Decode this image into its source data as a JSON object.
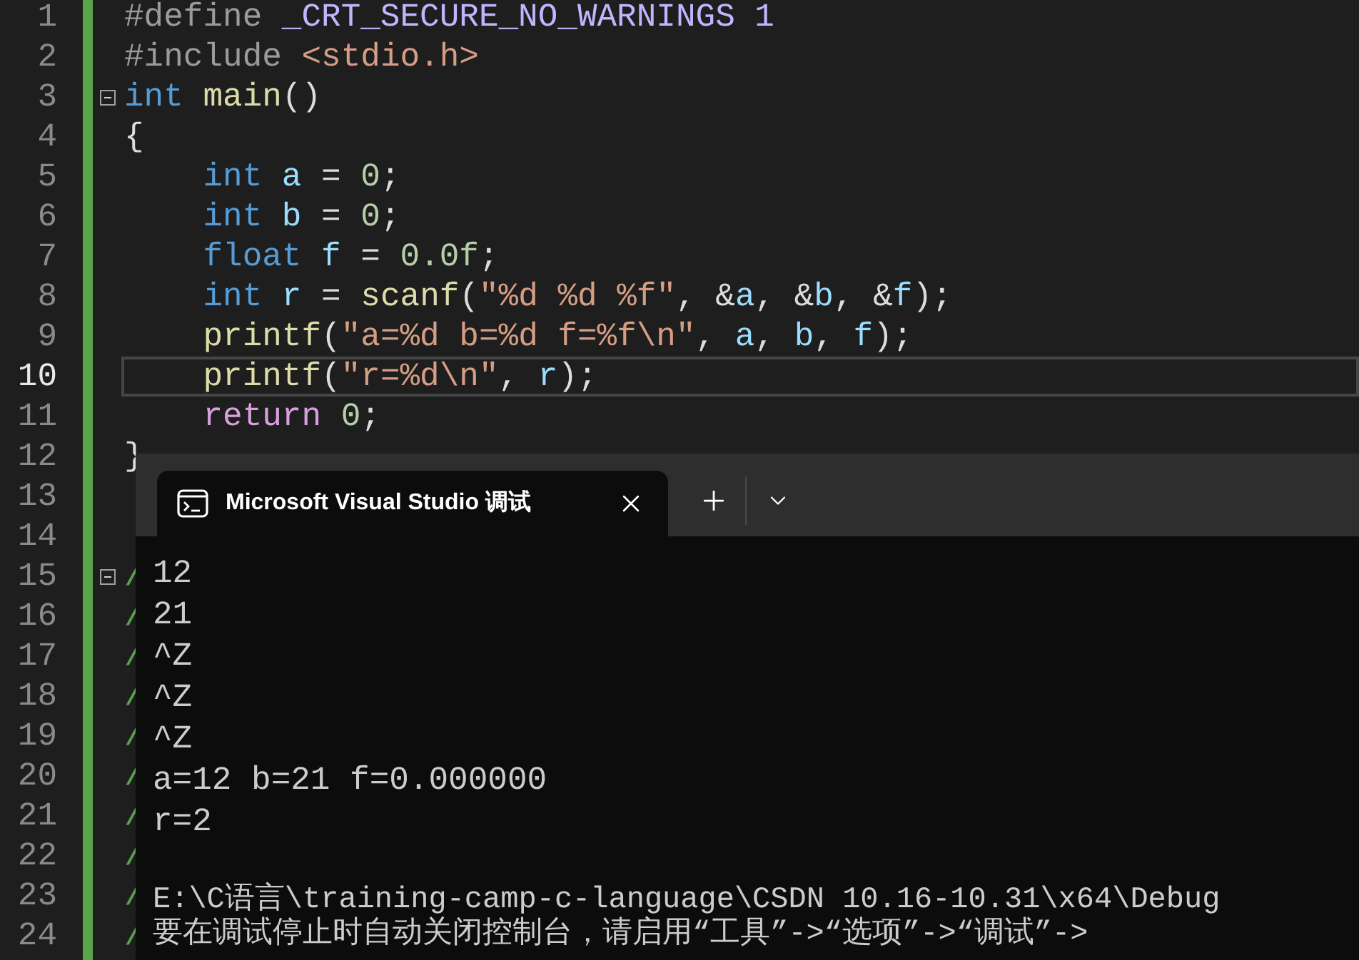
{
  "editor": {
    "lines": [
      {
        "number": "1",
        "current": false,
        "fold": false,
        "tokens": [
          {
            "text": "#define ",
            "kind": "preprocessor"
          },
          {
            "text": "_CRT_SECURE_NO_WARNINGS",
            "kind": "macro"
          },
          {
            "text": " 1",
            "kind": "macro"
          }
        ]
      },
      {
        "number": "2",
        "current": false,
        "fold": false,
        "tokens": [
          {
            "text": "#include ",
            "kind": "preprocessor"
          },
          {
            "text": "<stdio.h>",
            "kind": "string"
          }
        ]
      },
      {
        "number": "3",
        "current": false,
        "fold": true,
        "tokens": [
          {
            "text": "int",
            "kind": "keyword"
          },
          {
            "text": " main",
            "kind": "function"
          },
          {
            "text": "()",
            "kind": "plain"
          }
        ]
      },
      {
        "number": "4",
        "current": false,
        "fold": false,
        "tokens": [
          {
            "text": "{",
            "kind": "plain"
          }
        ]
      },
      {
        "number": "5",
        "current": false,
        "fold": false,
        "tokens": [
          {
            "text": "    int",
            "kind": "keyword"
          },
          {
            "text": " a",
            "kind": "variable"
          },
          {
            "text": " = ",
            "kind": "plain"
          },
          {
            "text": "0",
            "kind": "number"
          },
          {
            "text": ";",
            "kind": "plain"
          }
        ]
      },
      {
        "number": "6",
        "current": false,
        "fold": false,
        "tokens": [
          {
            "text": "    int",
            "kind": "keyword"
          },
          {
            "text": " b",
            "kind": "variable"
          },
          {
            "text": " = ",
            "kind": "plain"
          },
          {
            "text": "0",
            "kind": "number"
          },
          {
            "text": ";",
            "kind": "plain"
          }
        ]
      },
      {
        "number": "7",
        "current": false,
        "fold": false,
        "tokens": [
          {
            "text": "    float",
            "kind": "keyword"
          },
          {
            "text": " f",
            "kind": "variable"
          },
          {
            "text": " = ",
            "kind": "plain"
          },
          {
            "text": "0.0f",
            "kind": "number"
          },
          {
            "text": ";",
            "kind": "plain"
          }
        ]
      },
      {
        "number": "8",
        "current": false,
        "fold": false,
        "tokens": [
          {
            "text": "    int",
            "kind": "keyword"
          },
          {
            "text": " r",
            "kind": "variable"
          },
          {
            "text": " = ",
            "kind": "plain"
          },
          {
            "text": "scanf",
            "kind": "function"
          },
          {
            "text": "(",
            "kind": "plain"
          },
          {
            "text": "\"%d %d %f\"",
            "kind": "string"
          },
          {
            "text": ", &",
            "kind": "plain"
          },
          {
            "text": "a",
            "kind": "variable"
          },
          {
            "text": ", &",
            "kind": "plain"
          },
          {
            "text": "b",
            "kind": "variable"
          },
          {
            "text": ", &",
            "kind": "plain"
          },
          {
            "text": "f",
            "kind": "variable"
          },
          {
            "text": ");",
            "kind": "plain"
          }
        ]
      },
      {
        "number": "9",
        "current": false,
        "fold": false,
        "tokens": [
          {
            "text": "    printf",
            "kind": "function"
          },
          {
            "text": "(",
            "kind": "plain"
          },
          {
            "text": "\"a=%d b=%d f=%f\\n\"",
            "kind": "string"
          },
          {
            "text": ", ",
            "kind": "plain"
          },
          {
            "text": "a",
            "kind": "variable"
          },
          {
            "text": ", ",
            "kind": "plain"
          },
          {
            "text": "b",
            "kind": "variable"
          },
          {
            "text": ", ",
            "kind": "plain"
          },
          {
            "text": "f",
            "kind": "variable"
          },
          {
            "text": ");",
            "kind": "plain"
          }
        ]
      },
      {
        "number": "10",
        "current": true,
        "fold": false,
        "tokens": [
          {
            "text": "    printf",
            "kind": "function"
          },
          {
            "text": "(",
            "kind": "plain"
          },
          {
            "text": "\"r=%d\\n\"",
            "kind": "string"
          },
          {
            "text": ", ",
            "kind": "plain"
          },
          {
            "text": "r",
            "kind": "variable"
          },
          {
            "text": ");",
            "kind": "plain"
          }
        ]
      },
      {
        "number": "11",
        "current": false,
        "fold": false,
        "tokens": [
          {
            "text": "    return",
            "kind": "control"
          },
          {
            "text": " 0",
            "kind": "number"
          },
          {
            "text": ";",
            "kind": "plain"
          }
        ]
      },
      {
        "number": "12",
        "current": false,
        "fold": false,
        "tokens": [
          {
            "text": "}",
            "kind": "plain"
          }
        ]
      },
      {
        "number": "13",
        "current": false,
        "fold": false
      },
      {
        "number": "14",
        "current": false,
        "fold": false
      },
      {
        "number": "15",
        "current": false,
        "fold": true,
        "tokens": [
          {
            "text": "/",
            "kind": "comment"
          }
        ]
      },
      {
        "number": "16",
        "current": false,
        "fold": false,
        "tokens": [
          {
            "text": "/",
            "kind": "comment"
          }
        ]
      },
      {
        "number": "17",
        "current": false,
        "fold": false,
        "tokens": [
          {
            "text": "/",
            "kind": "comment"
          }
        ]
      },
      {
        "number": "18",
        "current": false,
        "fold": false,
        "tokens": [
          {
            "text": "/",
            "kind": "comment"
          }
        ]
      },
      {
        "number": "19",
        "current": false,
        "fold": false,
        "tokens": [
          {
            "text": "/",
            "kind": "comment"
          }
        ]
      },
      {
        "number": "20",
        "current": false,
        "fold": false,
        "tokens": [
          {
            "text": "/",
            "kind": "comment"
          }
        ]
      },
      {
        "number": "21",
        "current": false,
        "fold": false,
        "tokens": [
          {
            "text": "/",
            "kind": "comment"
          }
        ]
      },
      {
        "number": "22",
        "current": false,
        "fold": false,
        "tokens": [
          {
            "text": "/",
            "kind": "comment"
          }
        ]
      },
      {
        "number": "23",
        "current": false,
        "fold": false,
        "tokens": [
          {
            "text": "/",
            "kind": "comment"
          }
        ]
      },
      {
        "number": "24",
        "current": false,
        "fold": false,
        "tokens": [
          {
            "text": "/",
            "kind": "comment"
          }
        ]
      }
    ]
  },
  "terminal": {
    "tab": {
      "title": "Microsoft Visual Studio 调试",
      "selected": true
    },
    "output": [
      "12",
      "21",
      "^Z",
      "^Z",
      "^Z",
      "a=12 b=21 f=0.000000",
      "r=2"
    ],
    "messages": [
      "E:\\C语言\\training-camp-c-language\\CSDN 10.16-10.31\\x64\\Debug",
      "要在调试停止时自动关闭控制台，请启用“工具”->“选项”->“调试”->"
    ]
  }
}
